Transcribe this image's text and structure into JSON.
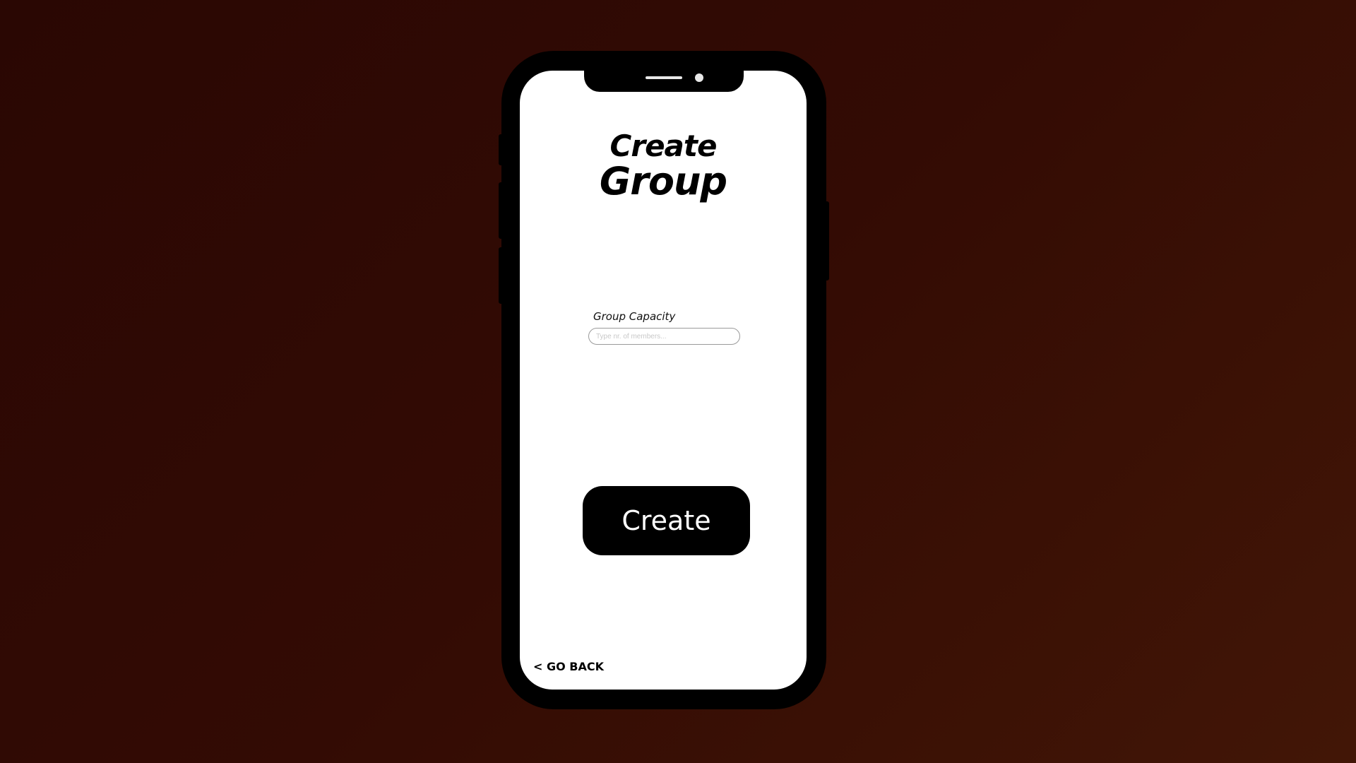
{
  "page": {
    "title_line1": "Create",
    "title_line2": "Group"
  },
  "form": {
    "capacity_label": "Group Capacity",
    "capacity_placeholder": "Type nr. of members...",
    "capacity_value": ""
  },
  "actions": {
    "create_label": "Create",
    "go_back_label": "< GO BACK"
  },
  "colors": {
    "background_dark": "#2a0703",
    "background_light": "#421606",
    "phone_frame": "#000000",
    "screen": "#ffffff",
    "button": "#000000",
    "button_text": "#ffffff"
  }
}
